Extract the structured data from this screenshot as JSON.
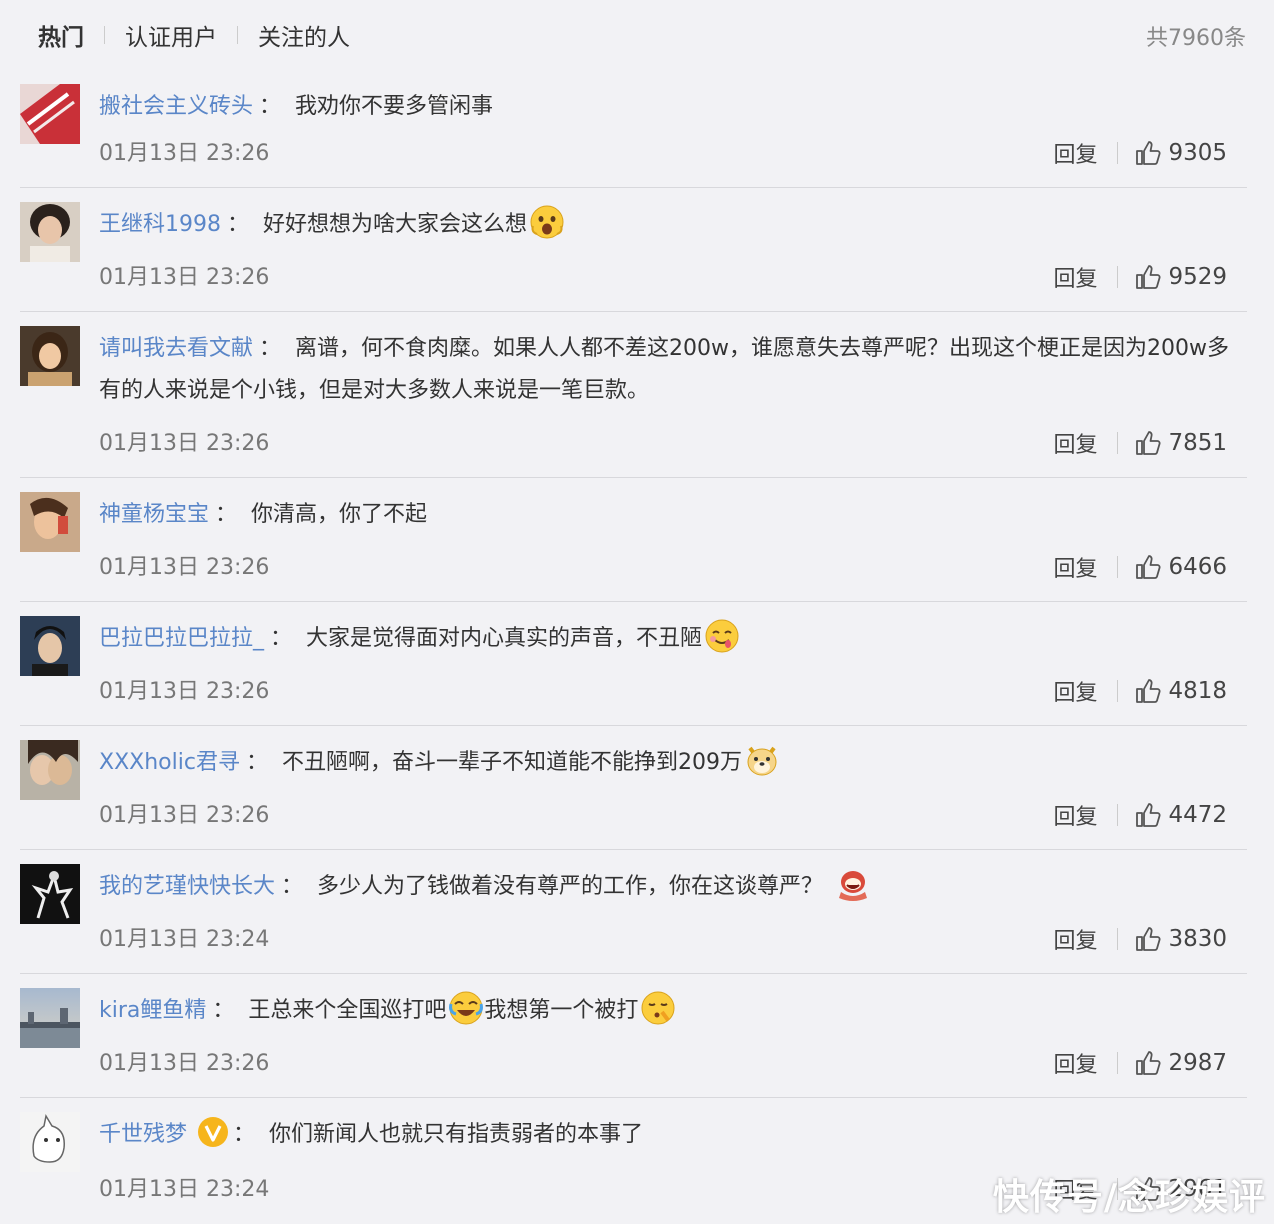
{
  "tabs": [
    {
      "label": "热门",
      "active": true
    },
    {
      "label": "认证用户",
      "active": false
    },
    {
      "label": "关注的人",
      "active": false
    }
  ],
  "total": "共7960条",
  "reply_label": "回复",
  "comments": [
    {
      "user": "搬社会主义砖头",
      "text": "我劝你不要多管闲事",
      "time": "01月13日 23:26",
      "likes": "9305"
    },
    {
      "user": "王继科1998",
      "text": "好好想想为啥大家会这么想",
      "time": "01月13日 23:26",
      "likes": "9529",
      "emoji": "scream-emoji"
    },
    {
      "user": "请叫我去看文献",
      "text": "离谱，何不食肉糜。如果人人都不差这200w，谁愿意失去尊严呢？出现这个梗正是因为200w多有的人来说是个小钱，但是对大多数人来说是一笔巨款。",
      "time": "01月13日 23:26",
      "likes": "7851"
    },
    {
      "user": "神童杨宝宝",
      "text": "你清高，你了不起",
      "time": "01月13日 23:26",
      "likes": "6466"
    },
    {
      "user": "巴拉巴拉巴拉拉_",
      "text": "大家是觉得面对内心真实的声音，不丑陋",
      "time": "01月13日 23:26",
      "likes": "4818",
      "emoji": "yum-emoji"
    },
    {
      "user": "XXXholic君寻",
      "text": "不丑陋啊，奋斗一辈子不知道能不能挣到209万",
      "time": "01月13日 23:26",
      "likes": "4472",
      "emoji": "doge-emoji"
    },
    {
      "user": "我的艺瑾快快长大",
      "text": "多少人为了钱做着没有尊严的工作，你在这谈尊严？",
      "time": "01月13日 23:24",
      "likes": "3830",
      "emoji": "laugh-cry-red-emoji"
    },
    {
      "user": "kira鲤鱼精",
      "text": "王总来个全国巡打吧",
      "text2": "我想第一个被打",
      "time": "01月13日 23:26",
      "likes": "2987",
      "emoji": "rofl-emoji",
      "emoji2": "shy-emoji"
    },
    {
      "user": "千世残梦",
      "text": "你们新闻人也就只有指责弱者的本事了",
      "time": "01月13日 23:24",
      "likes": "2961",
      "verified": true
    }
  ],
  "watermark": "快传号/念珍娱评",
  "colors": {
    "username": "#5a86c8",
    "background": "#f2f2f5",
    "divider": "#d8d8dc"
  }
}
